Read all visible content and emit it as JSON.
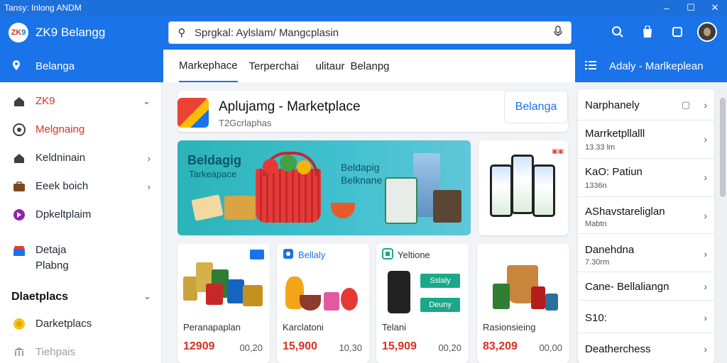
{
  "window": {
    "title": "Tansy: Inlong ANDM",
    "controls": [
      "–",
      "☐",
      "✕"
    ]
  },
  "header": {
    "logo_text": "ZK",
    "logo_accent": "9",
    "app_title": "ZK9 Belangg",
    "search_value": "Sprgkal: Aylslam/ Mangcplasin",
    "icons": [
      "search-icon",
      "bag-icon",
      "square-icon",
      "avatar"
    ]
  },
  "left_sub": {
    "label": "Belanga"
  },
  "sidebar": {
    "items": [
      {
        "icon": "home-icon",
        "label": "ZK9",
        "chevron": "⌄",
        "color": "#d93025"
      },
      {
        "icon": "camera-icon",
        "label": "Melgnaing",
        "color": "#d93025"
      },
      {
        "icon": "house-icon",
        "label": "Keldninain",
        "chevron": "›"
      },
      {
        "icon": "briefcase-icon",
        "label": "Eeek boich",
        "chevron": "›"
      },
      {
        "icon": "app-icon",
        "label": "Dpkeltplaim"
      },
      {
        "icon": "store-icon",
        "label": "Detaja",
        "label2": "Plabng"
      }
    ],
    "section": {
      "label": "Dlaetplacs",
      "chevron": "⌄"
    },
    "items2": [
      {
        "icon": "coin-icon",
        "label": "Darketplacs"
      },
      {
        "icon": "bank-icon",
        "label": "Tiehpais"
      }
    ]
  },
  "tabs": [
    "Markephace",
    "Terperchai",
    "ulitaur",
    "Belanpg"
  ],
  "app_card": {
    "name": "Aplujamg - Marketplace",
    "subtitle": "T2Gcrlaphas",
    "install_label": "Belanga"
  },
  "banner": {
    "title": "Beldagig",
    "subtitle": "Tarkeapace",
    "right1": "Beldapig",
    "right2": "Belknane"
  },
  "phones_card": {
    "tag": "▣▣"
  },
  "products": [
    {
      "top": "",
      "name": "Peranapaplan",
      "price": "12909",
      "old": "00,20"
    },
    {
      "top": "Bellaly",
      "name": "Karclatoni",
      "price": "15,900",
      "old": "10,30"
    },
    {
      "top": "Yeltione",
      "name": "Telani",
      "price": "15,909",
      "old": "00,20",
      "btn1": "Sslaly",
      "btn2": "Deuny"
    },
    {
      "top": "",
      "name": "Rasionsieing",
      "price": "83,209",
      "old": "00,00"
    }
  ],
  "right_sub": {
    "label": "Adaly - Marlkeplean"
  },
  "right_list": [
    {
      "title": "Narphanely",
      "sub": "",
      "extra": "▢",
      "chev": "›"
    },
    {
      "title": "Marrketpllalll",
      "sub": "13.33 lm",
      "chev": "›"
    },
    {
      "title": "KaO: Patiun",
      "sub": "1336n",
      "chev": "›"
    },
    {
      "title": "AShavstareliglan",
      "sub": "Mabtn",
      "chev": "›"
    },
    {
      "title": "Danehdna",
      "sub": "7.30rm",
      "chev": "›"
    },
    {
      "title": "Cane- Bellaliangn",
      "sub": "",
      "chev": "›"
    },
    {
      "title": "S10:",
      "sub": "",
      "chev": "›"
    },
    {
      "title": "Deatherchess",
      "sub": "",
      "chev": "›"
    }
  ]
}
